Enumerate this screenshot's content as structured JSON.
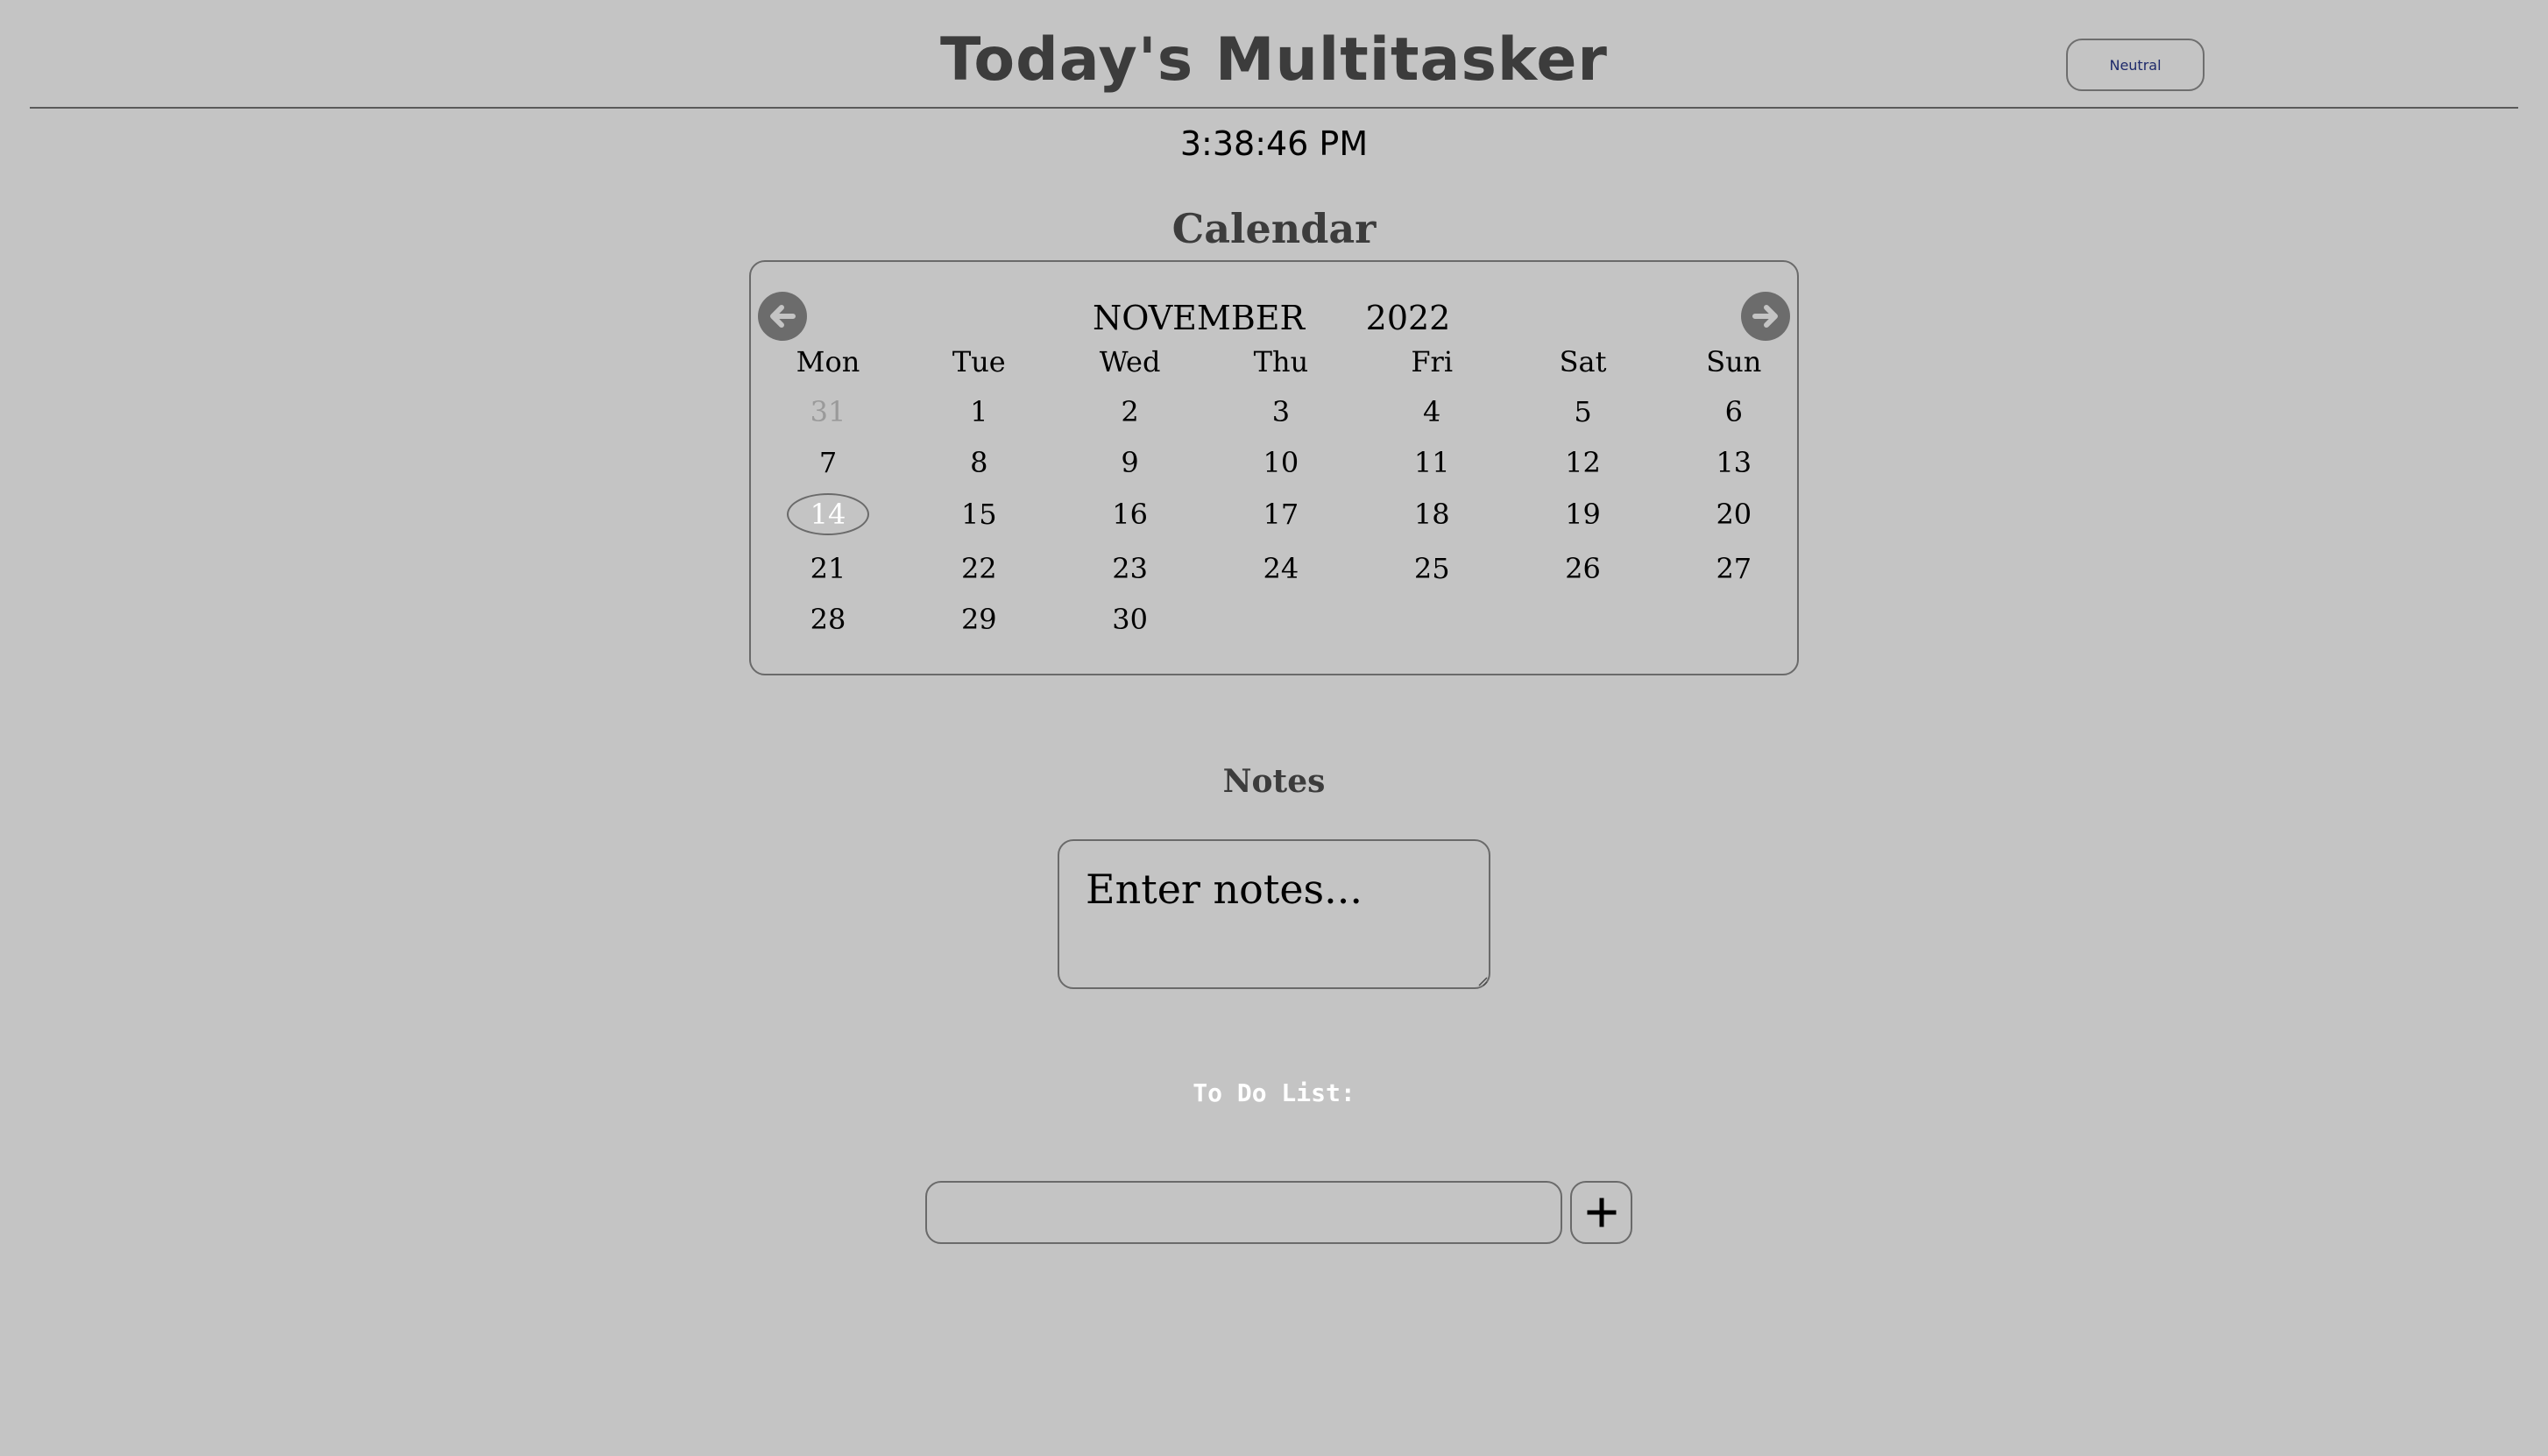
{
  "header": {
    "title": "Today's Multitasker",
    "mood_button_label": "Neutral"
  },
  "clock": {
    "time": "3:38:46 PM"
  },
  "calendar": {
    "heading": "Calendar",
    "month": "NOVEMBER",
    "year": "2022",
    "prev_icon": "arrow-left-circle-icon",
    "next_icon": "arrow-right-circle-icon",
    "weekdays": [
      "Mon",
      "Tue",
      "Wed",
      "Thu",
      "Fri",
      "Sat",
      "Sun"
    ],
    "weeks": [
      [
        "31",
        "1",
        "2",
        "3",
        "4",
        "5",
        "6"
      ],
      [
        "7",
        "8",
        "9",
        "10",
        "11",
        "12",
        "13"
      ],
      [
        "14",
        "15",
        "16",
        "17",
        "18",
        "19",
        "20"
      ],
      [
        "21",
        "22",
        "23",
        "24",
        "25",
        "26",
        "27"
      ],
      [
        "28",
        "29",
        "30",
        "",
        "",
        "",
        ""
      ]
    ],
    "muted_day": "31",
    "today": "14"
  },
  "notes": {
    "heading": "Notes",
    "placeholder": "Enter notes...",
    "value": ""
  },
  "todo": {
    "heading": "To Do List:",
    "input_value": "",
    "add_icon": "plus-icon"
  },
  "colors": {
    "background": "#c4c4c4",
    "heading_text": "#3c3c3c",
    "nav_button": "#6c6c6c",
    "muted_day": "#9a9a9a",
    "mood_button_text": "#1e2a6b",
    "todo_heading": "#ffffff"
  }
}
